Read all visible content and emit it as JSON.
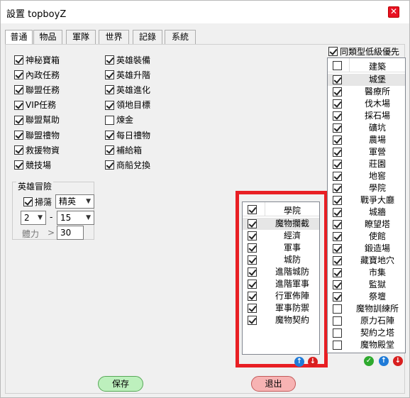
{
  "window": {
    "title": "設置 topboyZ",
    "close_glyph": "✕"
  },
  "tabs": [
    {
      "label": "普通"
    },
    {
      "label": "物品"
    },
    {
      "label": "軍隊"
    },
    {
      "label": "世界"
    },
    {
      "label": "記錄"
    },
    {
      "label": "系統"
    }
  ],
  "left_options": [
    {
      "label": "神秘寶箱",
      "checked": true
    },
    {
      "label": "內政任務",
      "checked": true
    },
    {
      "label": "聯盟任務",
      "checked": true
    },
    {
      "label": "VIP任務",
      "checked": true
    },
    {
      "label": "聯盟幫助",
      "checked": true
    },
    {
      "label": "聯盟禮物",
      "checked": true
    },
    {
      "label": "救援物資",
      "checked": true
    },
    {
      "label": "競技場",
      "checked": true
    }
  ],
  "right_options": [
    {
      "label": "英雄裝備",
      "checked": true
    },
    {
      "label": "英雄升階",
      "checked": true
    },
    {
      "label": "英雄進化",
      "checked": true
    },
    {
      "label": "領地目標",
      "checked": true
    },
    {
      "label": "煉金",
      "checked": false
    },
    {
      "label": "每日禮物",
      "checked": true
    },
    {
      "label": "補給箱",
      "checked": true
    },
    {
      "label": "商船兌換",
      "checked": true
    }
  ],
  "hero": {
    "group_label": "英雄冒險",
    "sweep_label": "掃蕩",
    "sweep_checked": true,
    "difficulty": "精英",
    "from": "2",
    "dash": "-",
    "to": "15",
    "stamina_label": "體力",
    "gt": ">",
    "stamina_value": "30"
  },
  "academy_list": {
    "header": "學院",
    "header_checked": true,
    "items": [
      {
        "label": "魔物攔截",
        "checked": true
      },
      {
        "label": "經濟",
        "checked": true
      },
      {
        "label": "軍事",
        "checked": true
      },
      {
        "label": "城防",
        "checked": true
      },
      {
        "label": "進階城防",
        "checked": true
      },
      {
        "label": "進階軍事",
        "checked": true
      },
      {
        "label": "行軍佈陣",
        "checked": true
      },
      {
        "label": "軍事防禦",
        "checked": true
      },
      {
        "label": "魔物契約",
        "checked": true
      }
    ]
  },
  "building": {
    "low_level_label": "同類型低級優先",
    "low_level_checked": true,
    "header": "建築",
    "header_checked": false,
    "items": [
      {
        "label": "城堡",
        "checked": true
      },
      {
        "label": "醫療所",
        "checked": true
      },
      {
        "label": "伐木場",
        "checked": true
      },
      {
        "label": "採石場",
        "checked": true
      },
      {
        "label": "礦坑",
        "checked": true
      },
      {
        "label": "農場",
        "checked": true
      },
      {
        "label": "軍營",
        "checked": true
      },
      {
        "label": "莊園",
        "checked": true
      },
      {
        "label": "地窖",
        "checked": true
      },
      {
        "label": "學院",
        "checked": true
      },
      {
        "label": "戰爭大廳",
        "checked": true
      },
      {
        "label": "城牆",
        "checked": true
      },
      {
        "label": "瞭望塔",
        "checked": true
      },
      {
        "label": "使館",
        "checked": true
      },
      {
        "label": "鍛造場",
        "checked": true
      },
      {
        "label": "藏寶地穴",
        "checked": true
      },
      {
        "label": "市集",
        "checked": true
      },
      {
        "label": "監獄",
        "checked": true
      },
      {
        "label": "祭壇",
        "checked": true
      },
      {
        "label": "魔物訓練所",
        "checked": false
      },
      {
        "label": "原力石陣",
        "checked": false
      },
      {
        "label": "契約之塔",
        "checked": false
      },
      {
        "label": "魔物殿堂",
        "checked": false
      }
    ]
  },
  "icons": {
    "up": "↑",
    "down": "↓",
    "ok": "✓"
  },
  "colors": {
    "highlight_border": "#e81f24",
    "save_bg": "#bdf0bd",
    "exit_bg": "#f7b3b3",
    "up_blue": "#1f7bd8",
    "down_red": "#d81f1f",
    "ok_green": "#2faa2f"
  },
  "buttons": {
    "save": "保存",
    "exit": "退出"
  }
}
